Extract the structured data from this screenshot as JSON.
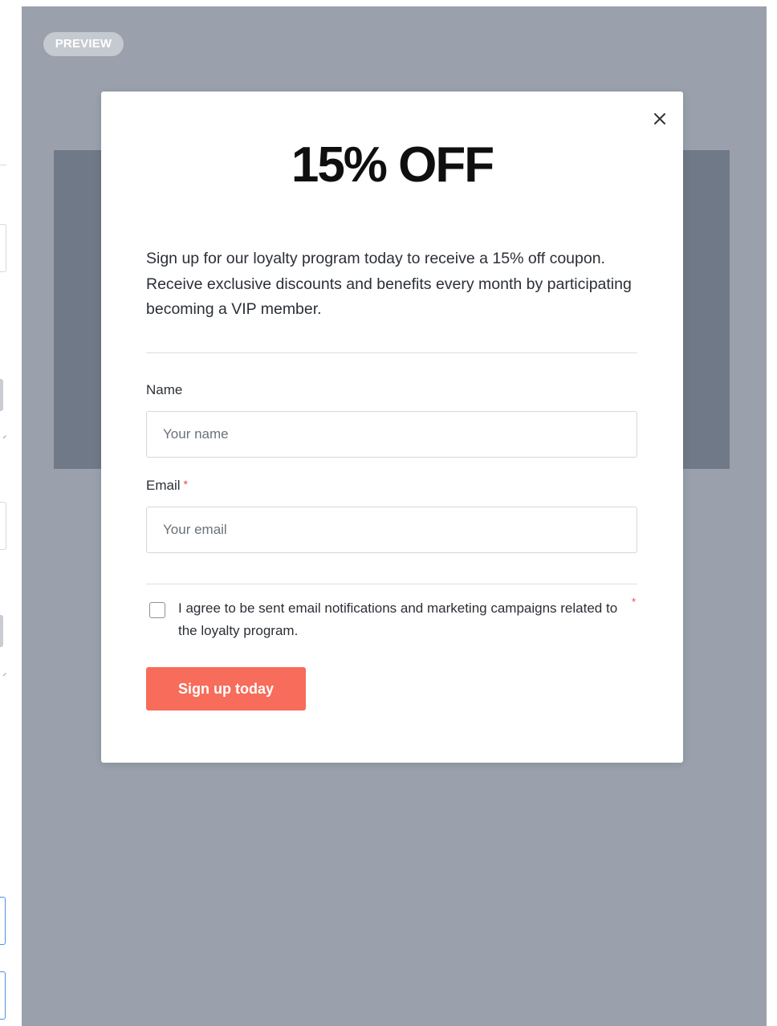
{
  "preview_badge": "PREVIEW",
  "modal": {
    "title": "15% OFF",
    "description": "Sign up for our loyalty program today to receive a 15% off coupon. Receive exclusive discounts and benefits every month by participating becoming a VIP member.",
    "close_icon": "close-icon",
    "name_field": {
      "label": "Name",
      "placeholder": "Your name",
      "value": ""
    },
    "email_field": {
      "label": "Email",
      "required_mark": "*",
      "placeholder": "Your email",
      "value": ""
    },
    "consent": {
      "text": "I agree to be sent email notifications and marketing campaigns related to the loyalty program.",
      "required_mark": "*",
      "checked": false
    },
    "submit_label": "Sign up today"
  },
  "colors": {
    "preview_bg": "#9aa1ac",
    "hero_block": "#707987",
    "button": "#f76c5a",
    "required": "#e5484d"
  }
}
